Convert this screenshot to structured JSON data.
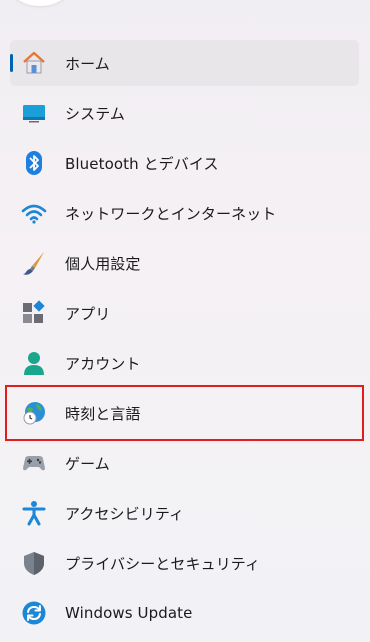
{
  "nav": {
    "items": [
      {
        "label": "ホーム",
        "icon": "home-icon",
        "selected": true
      },
      {
        "label": "システム",
        "icon": "system-display-icon",
        "selected": false
      },
      {
        "label": "Bluetooth とデバイス",
        "icon": "bluetooth-icon",
        "selected": false
      },
      {
        "label": "ネットワークとインターネット",
        "icon": "wifi-icon",
        "selected": false
      },
      {
        "label": "個人用設定",
        "icon": "paintbrush-icon",
        "selected": false
      },
      {
        "label": "アプリ",
        "icon": "apps-icon",
        "selected": false
      },
      {
        "label": "アカウント",
        "icon": "person-icon",
        "selected": false
      },
      {
        "label": "時刻と言語",
        "icon": "globe-clock-icon",
        "selected": false,
        "highlighted": true
      },
      {
        "label": "ゲーム",
        "icon": "gamepad-icon",
        "selected": false
      },
      {
        "label": "アクセシビリティ",
        "icon": "accessibility-icon",
        "selected": false
      },
      {
        "label": "プライバシーとセキュリティ",
        "icon": "shield-icon",
        "selected": false
      },
      {
        "label": "Windows Update",
        "icon": "update-icon",
        "selected": false
      }
    ]
  },
  "colors": {
    "accent": "#0063b1",
    "highlight_border": "#e01e1e",
    "selected_background": "#e9e6ea"
  }
}
